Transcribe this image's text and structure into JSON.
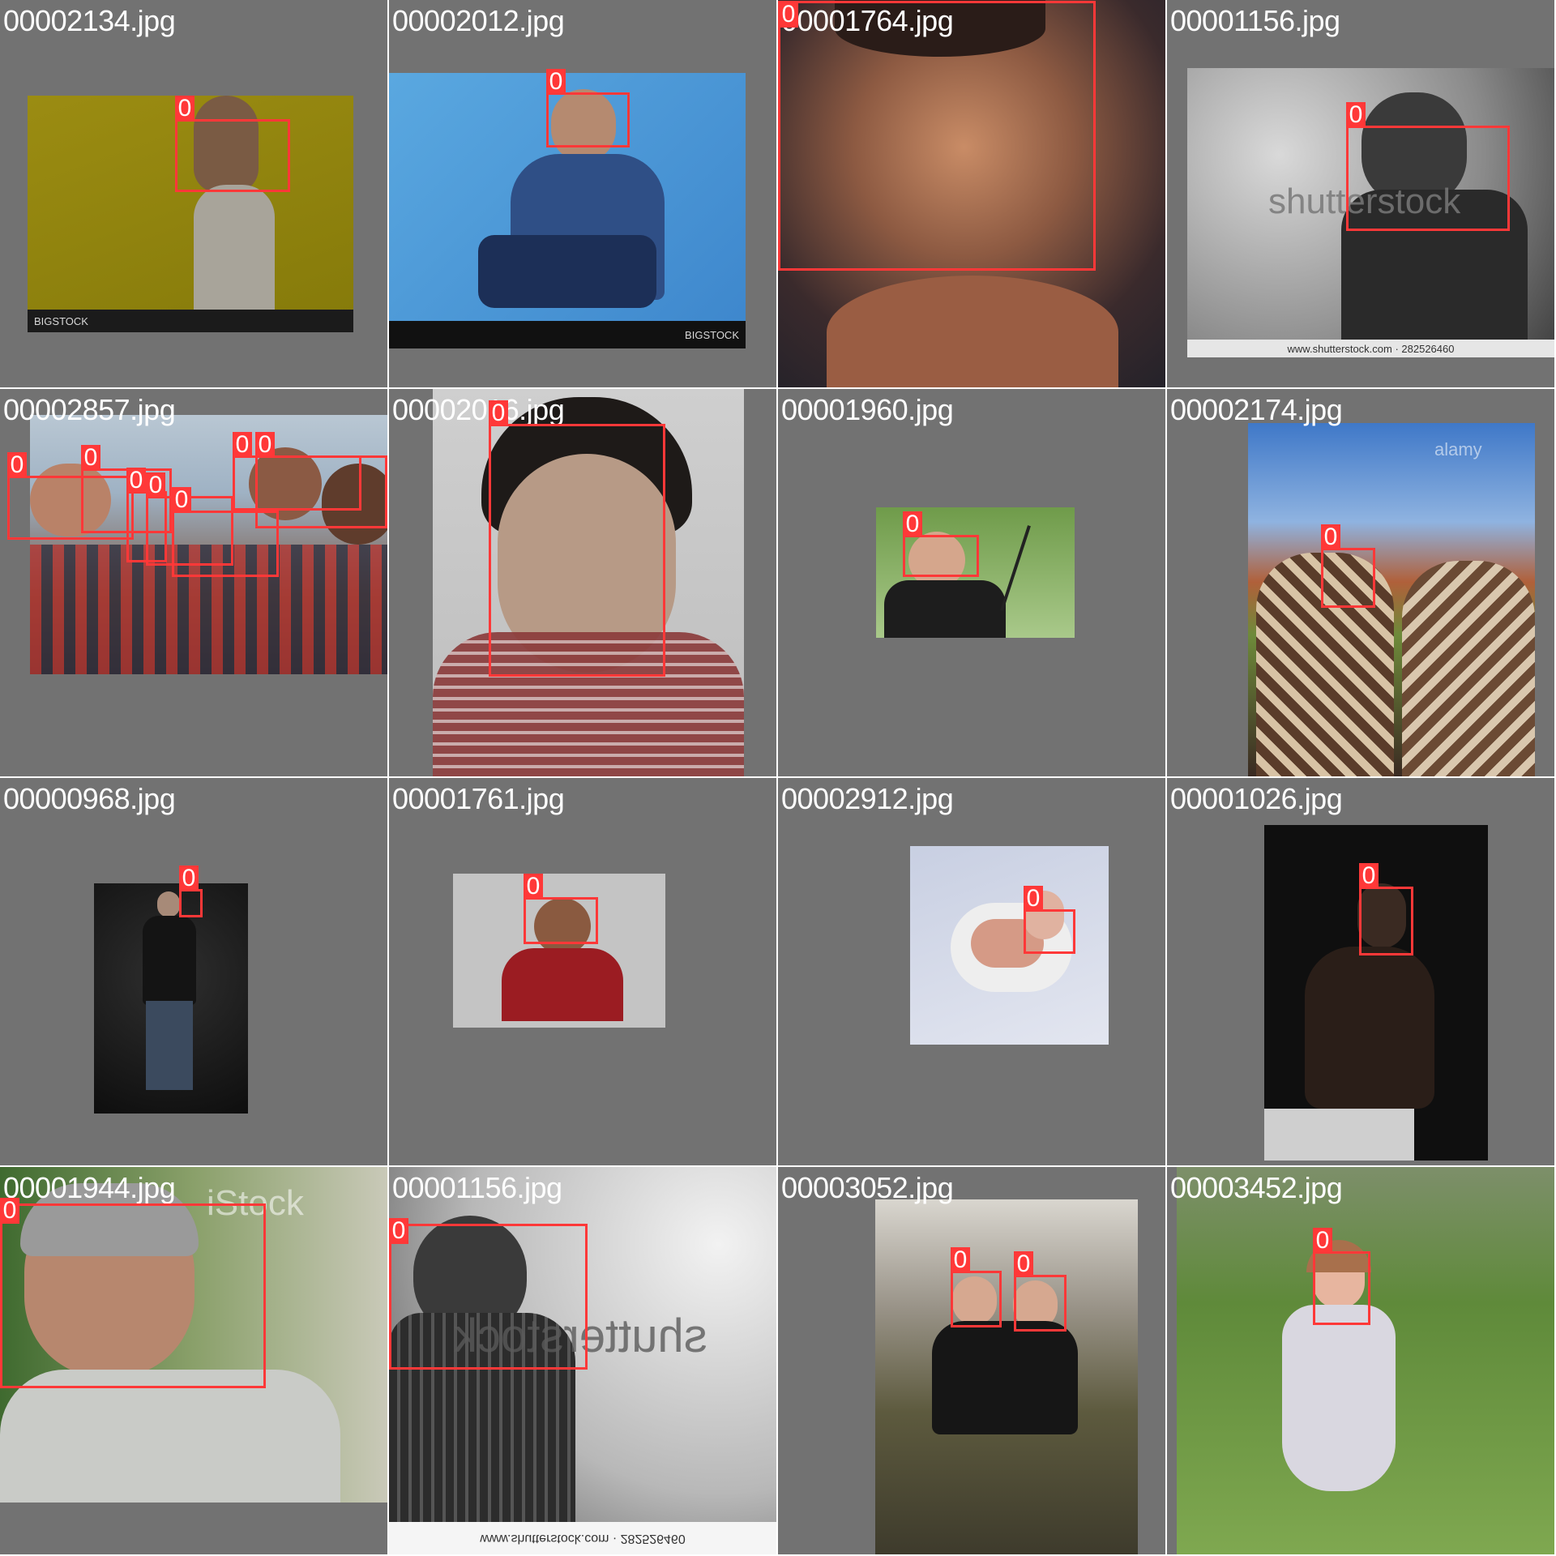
{
  "tiles": [
    {
      "filename": "00002134.jpg",
      "labels": [
        "0"
      ],
      "watermark": "BIGSTOCK"
    },
    {
      "filename": "00002012.jpg",
      "labels": [
        "0"
      ],
      "watermark": "BIGSTOCK"
    },
    {
      "filename": "00001764.jpg",
      "labels": [
        "0"
      ]
    },
    {
      "filename": "00001156.jpg",
      "labels": [
        "0"
      ],
      "watermark": "shutterstock",
      "caption": "www.shutterstock.com · 282526460"
    },
    {
      "filename": "00002857.jpg",
      "labels": [
        "0",
        "0",
        "0",
        "0",
        "0",
        "0",
        "0"
      ]
    },
    {
      "filename": "00002016.jpg",
      "labels": [
        "0"
      ]
    },
    {
      "filename": "00001960.jpg",
      "labels": [
        "0"
      ]
    },
    {
      "filename": "00002174.jpg",
      "labels": [
        "0"
      ],
      "watermark": "alamy"
    },
    {
      "filename": "00000968.jpg",
      "labels": [
        "0"
      ]
    },
    {
      "filename": "00001761.jpg",
      "labels": [
        "0"
      ]
    },
    {
      "filename": "00002912.jpg",
      "labels": [
        "0"
      ]
    },
    {
      "filename": "00001026.jpg",
      "labels": [
        "0"
      ]
    },
    {
      "filename": "00001944.jpg",
      "labels": [
        "0"
      ],
      "watermark": "iStock"
    },
    {
      "filename": "00001156.jpg",
      "labels": [
        "0"
      ],
      "watermark": "shutterstock",
      "caption": "www.shutterstock.com · 282526460"
    },
    {
      "filename": "00003052.jpg",
      "labels": [
        "0",
        "0"
      ]
    },
    {
      "filename": "00003452.jpg",
      "labels": [
        "0"
      ]
    }
  ],
  "colors": {
    "tile_background": "#727272",
    "box": "#ff3838",
    "label_text": "#ffffff"
  }
}
